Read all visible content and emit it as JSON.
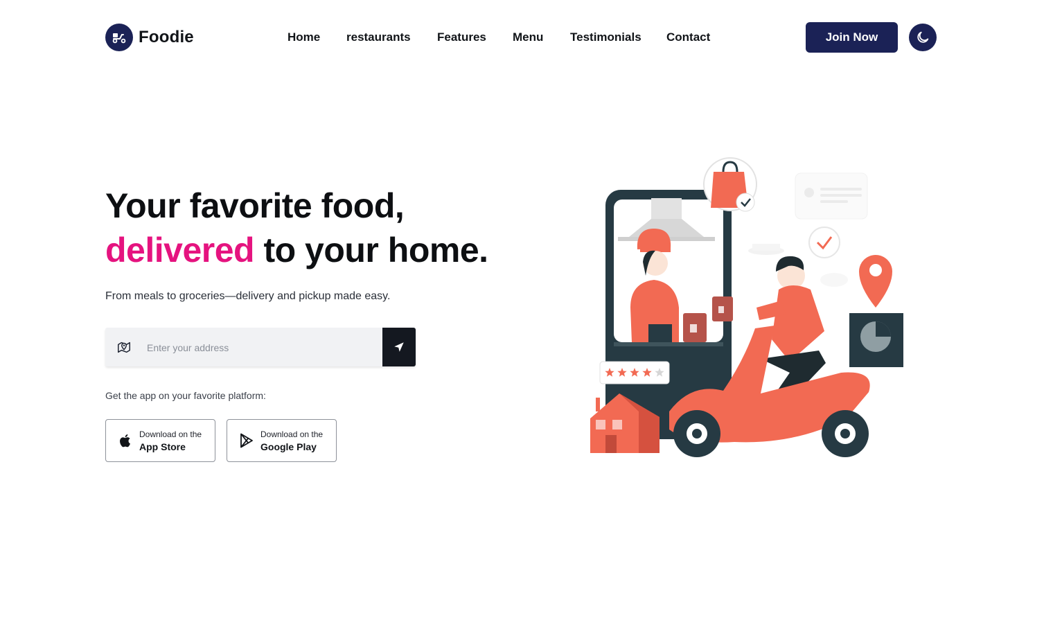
{
  "brand": {
    "name": "Foodie",
    "icon": "scooter-icon",
    "color": "#1b2256"
  },
  "nav": {
    "items": [
      {
        "label": "Home"
      },
      {
        "label": "restaurants"
      },
      {
        "label": "Features"
      },
      {
        "label": "Menu"
      },
      {
        "label": "Testimonials"
      },
      {
        "label": "Contact"
      }
    ]
  },
  "header": {
    "join_label": "Join Now",
    "theme_icon": "moon-icon"
  },
  "hero": {
    "title_line1": "Your favorite food,",
    "title_accent": "delivered",
    "title_rest": " to your home.",
    "accent_color": "#e5137f",
    "subtitle": "From meals to groceries—delivery and pickup made easy.",
    "address": {
      "placeholder": "Enter your address",
      "value": "",
      "icon": "map-pin-icon",
      "submit_icon": "send-arrow-icon"
    },
    "platform_text": "Get the app on your favorite platform:",
    "stores": [
      {
        "line1": "Download on the",
        "line2": "App Store",
        "icon": "apple-icon"
      },
      {
        "line1": "Download on the",
        "line2": "Google Play",
        "icon": "google-play-icon"
      }
    ]
  },
  "illustration": {
    "rating_stars": 4,
    "rating_max": 5
  }
}
